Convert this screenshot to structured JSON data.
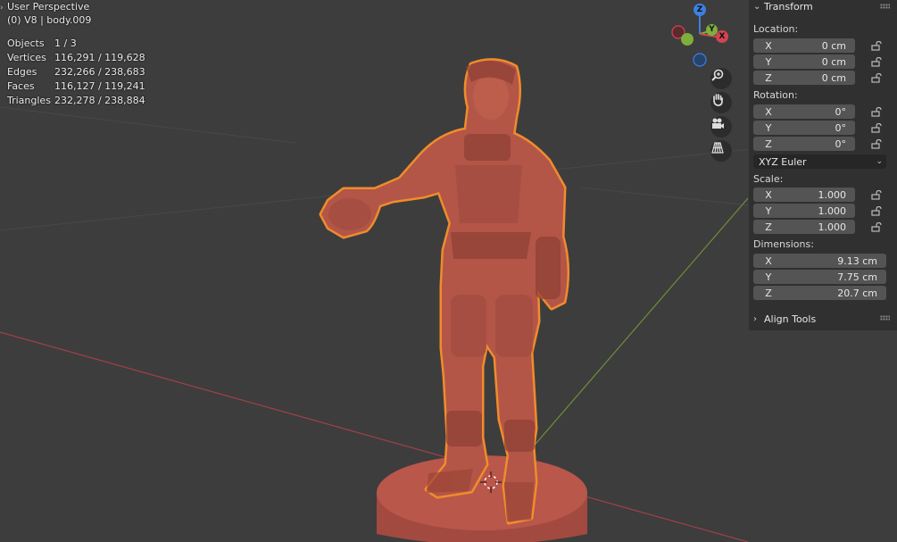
{
  "viewport": {
    "title": "User Perspective",
    "subtitle": "(0) V8 | body.009",
    "stats": [
      {
        "key": "Objects",
        "value": "1 / 3"
      },
      {
        "key": "Vertices",
        "value": "116,291 / 119,628"
      },
      {
        "key": "Edges",
        "value": "232,266 / 238,683"
      },
      {
        "key": "Faces",
        "value": "116,127 / 119,241"
      },
      {
        "key": "Triangles",
        "value": "232,278 / 238,884"
      }
    ],
    "gizmo": {
      "z": "Z",
      "y": "Y",
      "x": "X"
    }
  },
  "panel": {
    "header": "Transform",
    "location_label": "Location:",
    "location": [
      {
        "axis": "X",
        "value": "0 cm"
      },
      {
        "axis": "Y",
        "value": "0 cm"
      },
      {
        "axis": "Z",
        "value": "0 cm"
      }
    ],
    "rotation_label": "Rotation:",
    "rotation": [
      {
        "axis": "X",
        "value": "0°"
      },
      {
        "axis": "Y",
        "value": "0°"
      },
      {
        "axis": "Z",
        "value": "0°"
      }
    ],
    "rotation_mode": "XYZ Euler",
    "scale_label": "Scale:",
    "scale": [
      {
        "axis": "X",
        "value": "1.000"
      },
      {
        "axis": "Y",
        "value": "1.000"
      },
      {
        "axis": "Z",
        "value": "1.000"
      }
    ],
    "dimensions_label": "Dimensions:",
    "dimensions": [
      {
        "axis": "X",
        "value": "9.13 cm"
      },
      {
        "axis": "Y",
        "value": "7.75 cm"
      },
      {
        "axis": "Z",
        "value": "20.7 cm"
      }
    ],
    "align_tools": "Align Tools"
  },
  "colors": {
    "background": "#3d3d3d",
    "panel": "#303030",
    "field": "#545454",
    "model": "#b5584a",
    "outline": "#f08c2c",
    "x_axis": "#d24452",
    "y_axis": "#7fae3c",
    "z_axis": "#3d7fe0"
  }
}
